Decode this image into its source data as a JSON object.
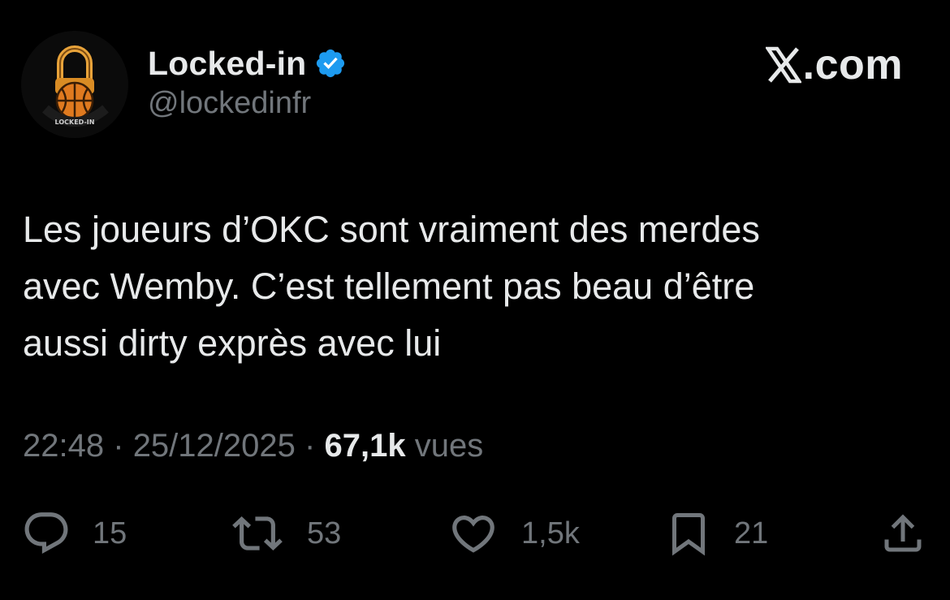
{
  "author": {
    "display_name": "Locked-in",
    "handle": "@lockedinfr",
    "verified": true,
    "avatar_text": "LOCKED-IN"
  },
  "site": {
    "logo_text": ".com"
  },
  "tweet": {
    "lines": [
      "Les joueurs d’OKC sont vraiment des merdes",
      "avec Wemby. C’est tellement pas beau d’être",
      "aussi dirty exprès avec lui"
    ],
    "time": "22:48",
    "date": "25/12/2025",
    "separator": "·",
    "views_count": "67,1k",
    "views_label": "vues"
  },
  "actions": {
    "replies": "15",
    "reposts": "53",
    "likes": "1,5k",
    "bookmarks": "21"
  },
  "icons": {
    "verified": "verified-badge-icon",
    "reply": "comment-bubble-icon",
    "repost": "repost-arrows-icon",
    "like": "heart-icon",
    "bookmark": "bookmark-icon",
    "share": "share-upload-icon"
  },
  "colors": {
    "background": "#000000",
    "text": "#e7e9ea",
    "muted": "#71767b",
    "verified": "#1d9bf0",
    "avatar_accent": "#e8a33a"
  }
}
